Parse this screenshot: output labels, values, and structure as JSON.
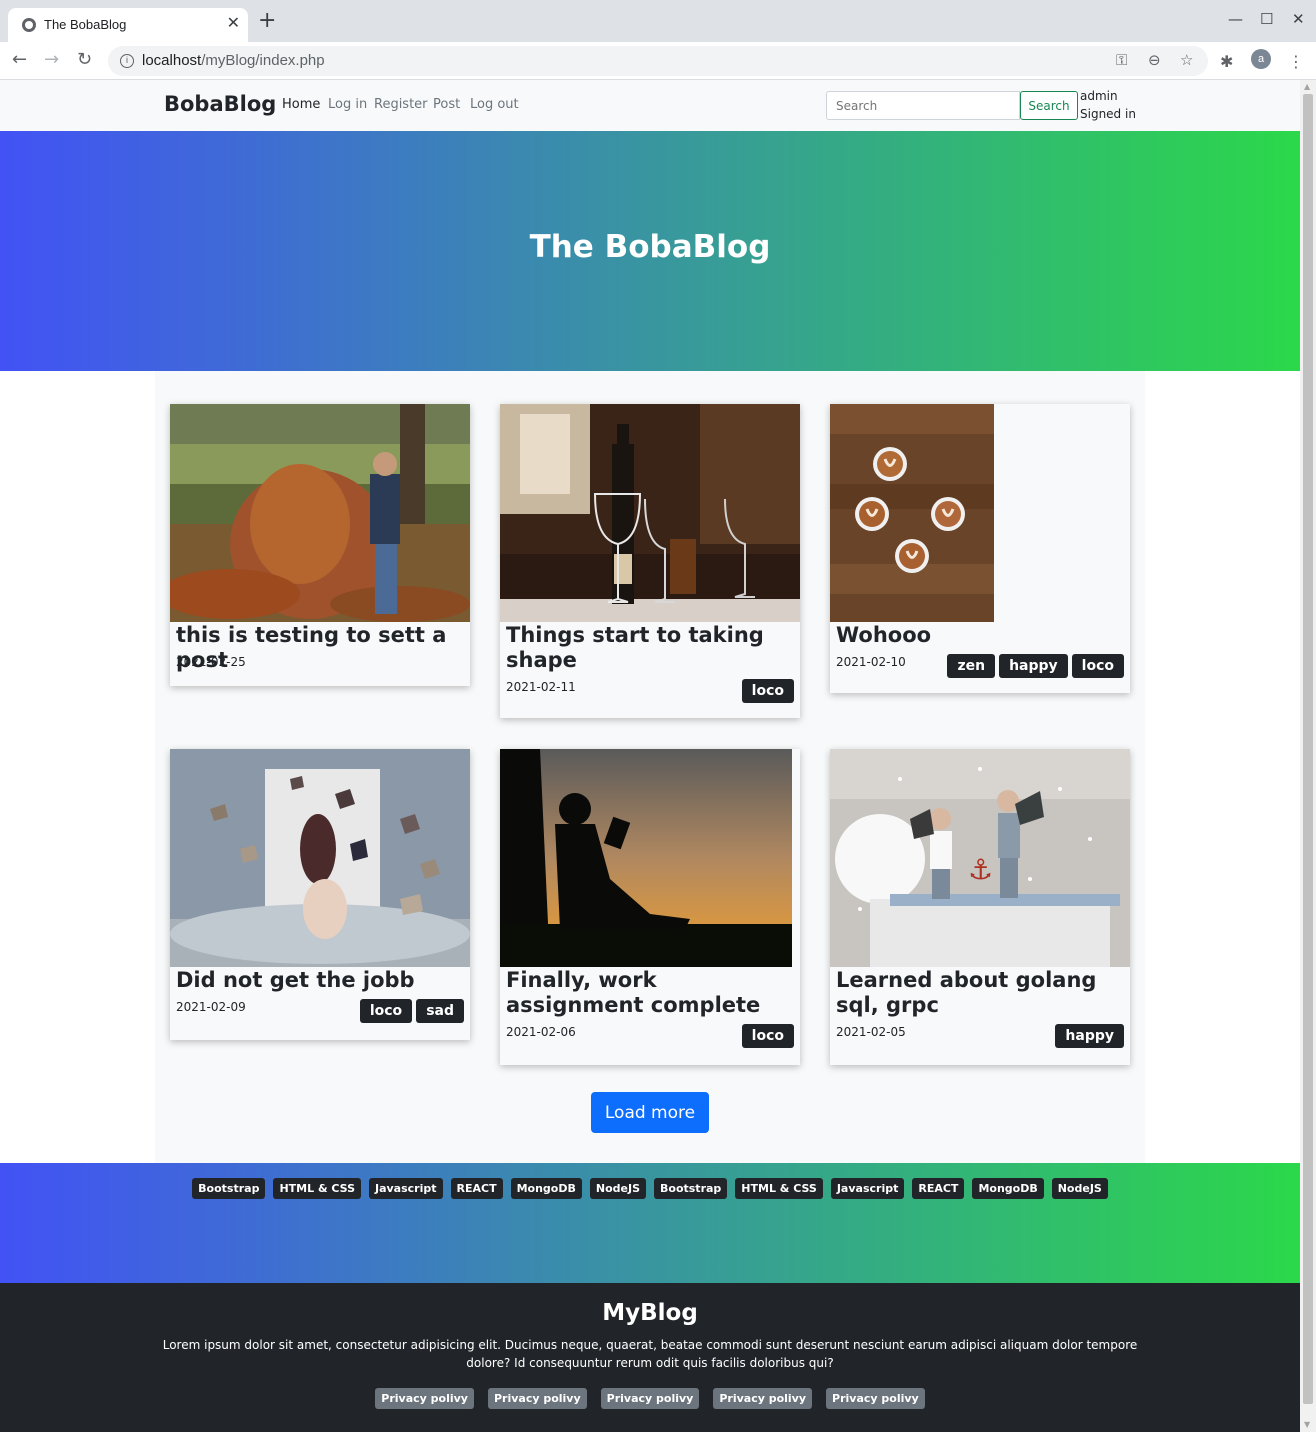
{
  "browser": {
    "tab_title": "The BobaBlog",
    "tab_close": "✕",
    "new_tab": "+",
    "url_host": "localhost",
    "url_path": "/myBlog/index.php",
    "profile_initial": "a"
  },
  "navbar": {
    "brand": "BobaBlog",
    "links": [
      "Home",
      "Log in",
      "Register",
      "Post",
      "Log out"
    ],
    "search_placeholder": "Search",
    "search_button": "Search",
    "user_name": "admin",
    "user_status": "Signed in"
  },
  "hero": {
    "title": "The BobaBlog"
  },
  "posts": [
    {
      "title": "this is testing to sett a post",
      "date": "2021-02-25",
      "tags": [],
      "image": "autumn-leaves-child"
    },
    {
      "title": "Things start to taking shape",
      "date": "2021-02-11",
      "tags": [
        "loco"
      ],
      "image": "wine-glasses-table"
    },
    {
      "title": "Wohooo",
      "date": "2021-02-10",
      "tags": [
        "zen",
        "happy",
        "loco"
      ],
      "image": "coffee-cups-overhead"
    },
    {
      "title": "Did not get the jobb",
      "date": "2021-02-09",
      "tags": [
        "loco",
        "sad"
      ],
      "image": "flying-books-room"
    },
    {
      "title": "Finally, work assignment complete",
      "date": "2021-02-06",
      "tags": [
        "loco"
      ],
      "image": "silhouette-reading-sunset"
    },
    {
      "title": "Learned about golang sql, grpc",
      "date": "2021-02-05",
      "tags": [
        "happy"
      ],
      "image": "pillow-fight-kids"
    }
  ],
  "load_more": "Load more",
  "tech_tags": [
    "Bootstrap",
    "HTML & CSS",
    "Javascript",
    "REACT",
    "MongoDB",
    "NodeJS",
    "Bootstrap",
    "HTML & CSS",
    "Javascript",
    "REACT",
    "MongoDB",
    "NodeJS"
  ],
  "footer": {
    "title": "MyBlog",
    "text": "Lorem ipsum dolor sit amet, consectetur adipisicing elit. Ducimus neque, quaerat, beatae commodi sunt deserunt nesciunt earum adipisci aliquam dolor tempore dolore? Id consequuntur rerum odit quis facilis doloribus qui?",
    "links": [
      "Privacy polivy",
      "Privacy polivy",
      "Privacy polivy",
      "Privacy polivy",
      "Privacy polivy"
    ]
  },
  "colors": {
    "gradient_start": "#4252f5",
    "gradient_end": "#2bd84a",
    "primary_button": "#0d6efd",
    "search_button": "#198754",
    "dark": "#212529"
  }
}
